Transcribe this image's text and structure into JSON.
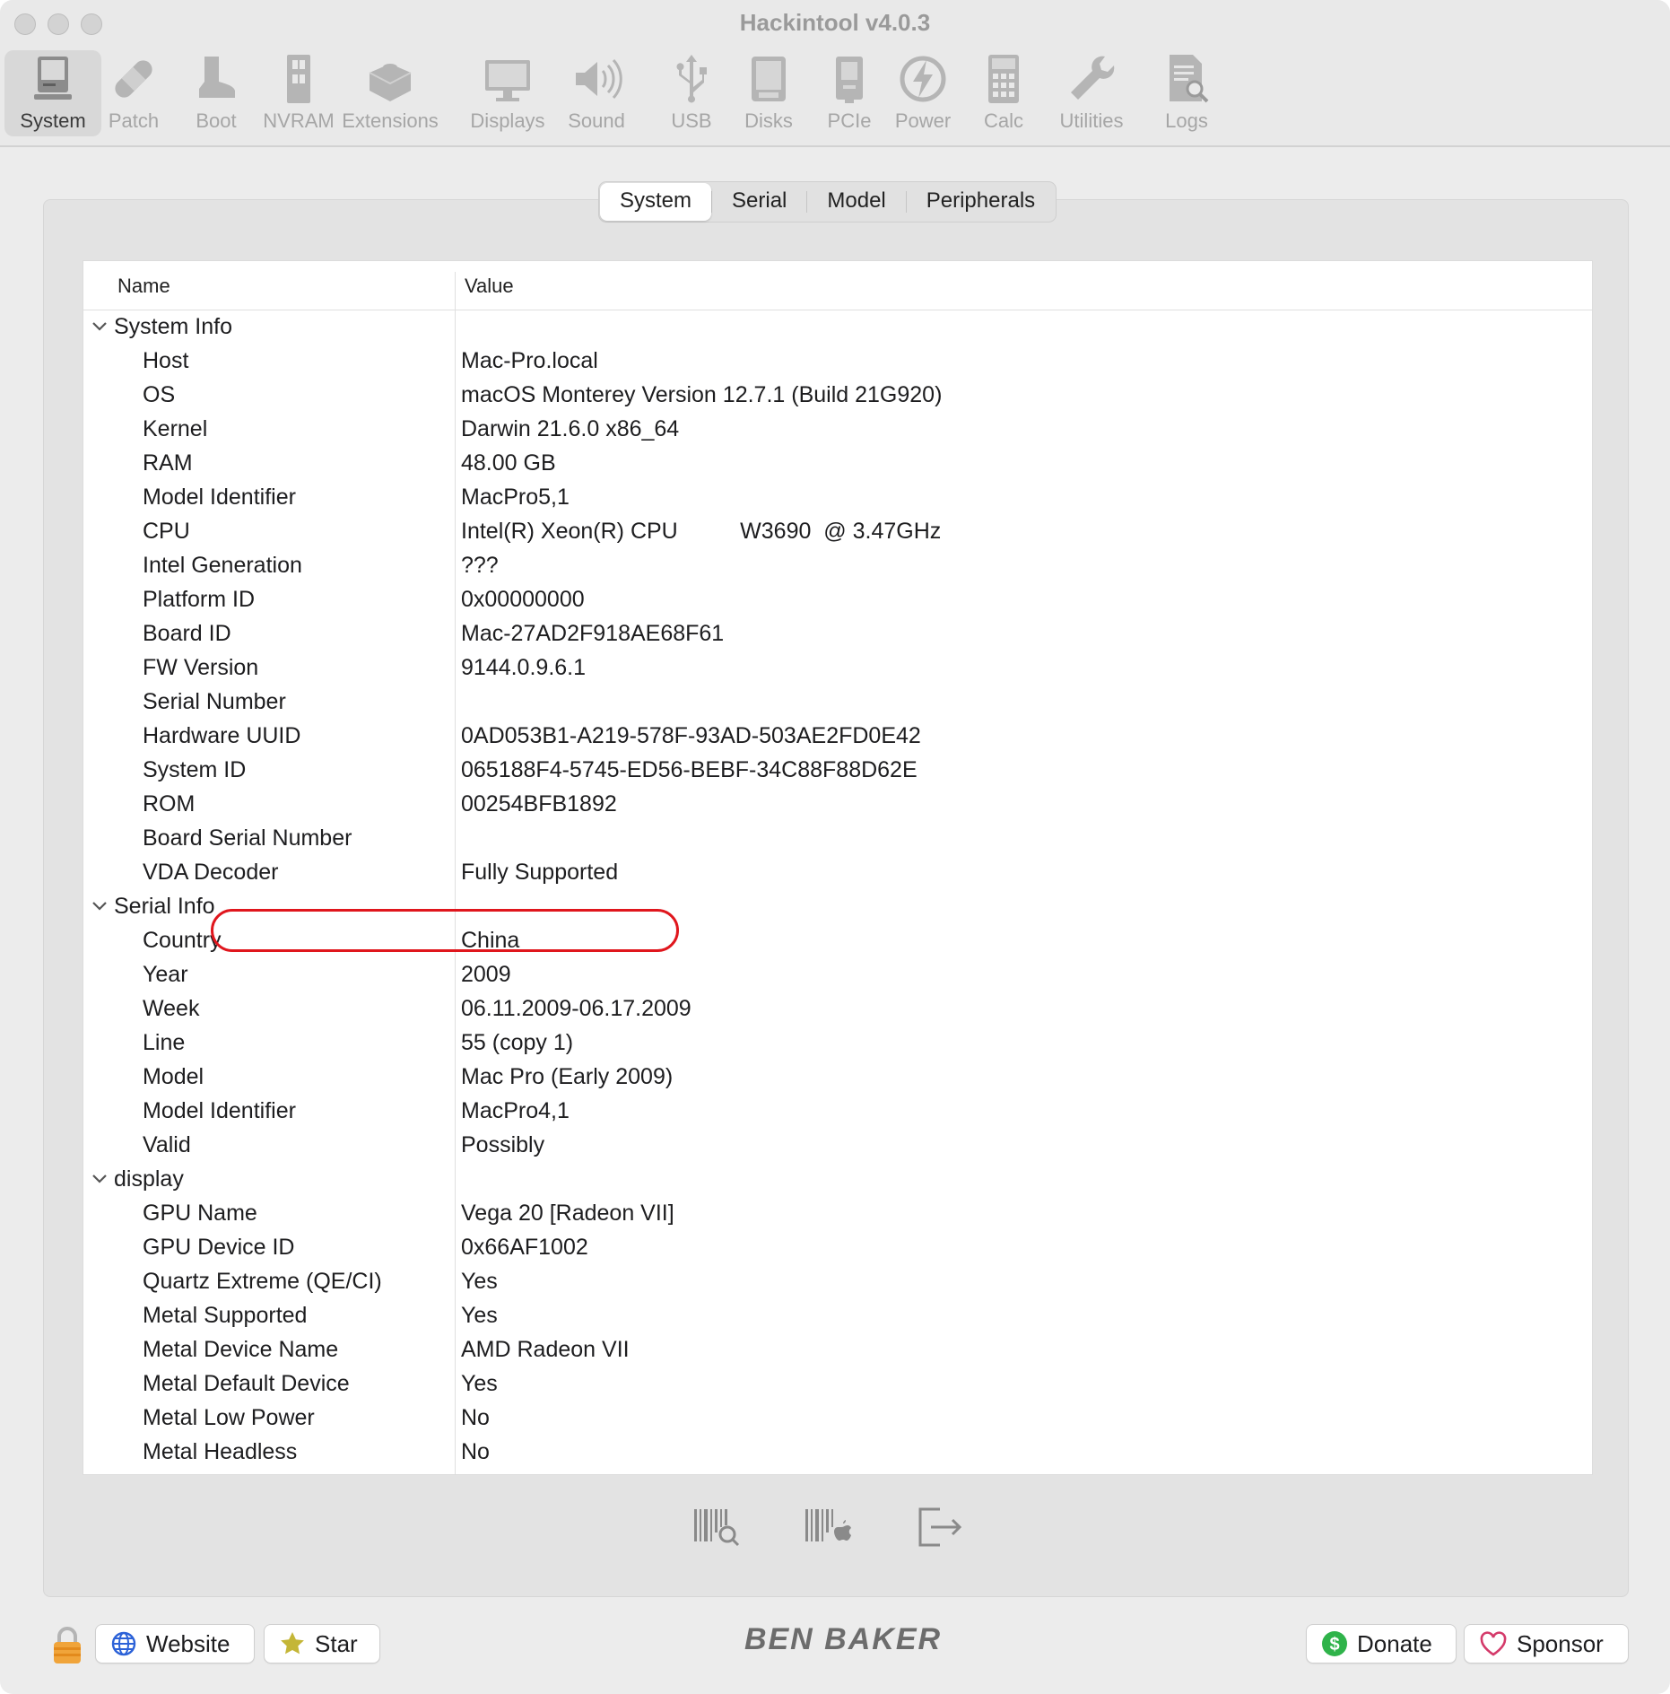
{
  "window": {
    "title": "Hackintool v4.0.3"
  },
  "toolbar": {
    "items": [
      {
        "label": "System",
        "icon": "computer-icon",
        "active": true
      },
      {
        "label": "Patch",
        "icon": "bandage-icon"
      },
      {
        "label": "Boot",
        "icon": "boot-icon"
      },
      {
        "label": "NVRAM",
        "icon": "memory-icon"
      },
      {
        "label": "Extensions",
        "icon": "lego-icon"
      },
      {
        "label": "Displays",
        "icon": "display-icon"
      },
      {
        "label": "Sound",
        "icon": "speaker-icon"
      },
      {
        "label": "USB",
        "icon": "usb-icon"
      },
      {
        "label": "Disks",
        "icon": "disk-icon"
      },
      {
        "label": "PCIe",
        "icon": "pcie-card-icon"
      },
      {
        "label": "Power",
        "icon": "power-bolt-icon"
      },
      {
        "label": "Calc",
        "icon": "calculator-icon"
      },
      {
        "label": "Utilities",
        "icon": "wrench-icon"
      },
      {
        "label": "Logs",
        "icon": "log-search-icon"
      }
    ]
  },
  "tabs": {
    "items": [
      {
        "label": "System",
        "active": true
      },
      {
        "label": "Serial"
      },
      {
        "label": "Model"
      },
      {
        "label": "Peripherals"
      }
    ]
  },
  "table": {
    "headers": {
      "name": "Name",
      "value": "Value"
    },
    "rows": [
      {
        "group": true,
        "name": "System Info",
        "value": ""
      },
      {
        "name": "Host",
        "value": "Mac-Pro.local"
      },
      {
        "name": "OS",
        "value": "macOS Monterey Version 12.7.1 (Build 21G920)"
      },
      {
        "name": "Kernel",
        "value": "Darwin 21.6.0 x86_64"
      },
      {
        "name": "RAM",
        "value": "48.00 GB"
      },
      {
        "name": "Model Identifier",
        "value": "MacPro5,1"
      },
      {
        "name": "CPU",
        "value": "Intel(R) Xeon(R) CPU          W3690  @ 3.47GHz"
      },
      {
        "name": "Intel Generation",
        "value": "???"
      },
      {
        "name": "Platform ID",
        "value": "0x00000000"
      },
      {
        "name": "Board ID",
        "value": "Mac-27AD2F918AE68F61"
      },
      {
        "name": "FW Version",
        "value": "9144.0.9.6.1",
        "highlighted": true
      },
      {
        "name": "Serial Number",
        "value": ""
      },
      {
        "name": "Hardware UUID",
        "value": "0AD053B1-A219-578F-93AD-503AE2FD0E42"
      },
      {
        "name": "System ID",
        "value": "065188F4-5745-ED56-BEBF-34C88F88D62E"
      },
      {
        "name": "ROM",
        "value": "00254BFB1892"
      },
      {
        "name": "Board Serial Number",
        "value": ""
      },
      {
        "name": "VDA Decoder",
        "value": "Fully Supported"
      },
      {
        "group": true,
        "name": "Serial Info",
        "value": ""
      },
      {
        "name": "Country",
        "value": "China"
      },
      {
        "name": "Year",
        "value": "2009"
      },
      {
        "name": "Week",
        "value": "06.11.2009-06.17.2009"
      },
      {
        "name": "Line",
        "value": "55 (copy 1)"
      },
      {
        "name": "Model",
        "value": "Mac Pro (Early 2009)"
      },
      {
        "name": "Model Identifier",
        "value": "MacPro4,1"
      },
      {
        "name": "Valid",
        "value": "Possibly"
      },
      {
        "group": true,
        "name": "display",
        "value": ""
      },
      {
        "name": "GPU Name",
        "value": "Vega 20 [Radeon VII]"
      },
      {
        "name": "GPU Device ID",
        "value": "0x66AF1002"
      },
      {
        "name": "Quartz Extreme (QE/CI)",
        "value": "Yes"
      },
      {
        "name": "Metal Supported",
        "value": "Yes"
      },
      {
        "name": "Metal Device Name",
        "value": "AMD Radeon VII"
      },
      {
        "name": "Metal Default Device",
        "value": "Yes"
      },
      {
        "name": "Metal Low Power",
        "value": "No"
      },
      {
        "name": "Metal Headless",
        "value": "No"
      }
    ]
  },
  "actions": [
    {
      "icon": "barcode-search-icon"
    },
    {
      "icon": "barcode-apple-icon"
    },
    {
      "icon": "export-icon"
    }
  ],
  "footer": {
    "lock_icon": "lock-icon",
    "website_label": "Website",
    "star_label": "Star",
    "logo_text": "BEN BAKER",
    "donate_label": "Donate",
    "sponsor_label": "Sponsor"
  },
  "colors": {
    "highlight": "#e0161d",
    "donate": "#2fb34a",
    "sponsor": "#d43a6a"
  }
}
